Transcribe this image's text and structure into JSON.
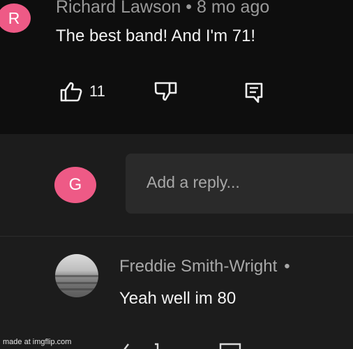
{
  "comment": {
    "avatar_letter": "R",
    "author": "Richard Lawson",
    "separator": "•",
    "time": "8 mo ago",
    "text": "The best band! And I'm 71!",
    "like_count": "11"
  },
  "reply_composer": {
    "avatar_letter": "G",
    "placeholder": "Add a reply..."
  },
  "reply": {
    "author": "Freddie Smith-Wright",
    "separator": "•",
    "text": "Yeah well im 80"
  },
  "icons": {
    "like": "thumbs-up-icon",
    "dislike": "thumbs-down-icon",
    "reply": "comment-icon"
  },
  "watermark": "made at imgflip.com",
  "colors": {
    "avatar_accent": "#ee5a86",
    "background": "#1c1c1c",
    "top_panel": "#0e0e0e",
    "input_background": "#2a2a2a",
    "muted_text": "#9a9a9a"
  }
}
